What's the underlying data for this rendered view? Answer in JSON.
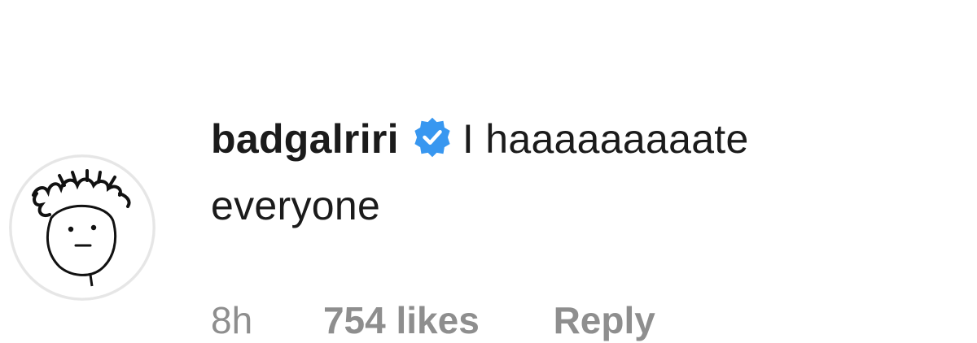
{
  "comment": {
    "username": "badgalriri",
    "verified_icon": "verified-badge-icon",
    "text_line1": "I haaaaaaaaate",
    "text_line2": "everyone",
    "time": "8h",
    "likes": "754 likes",
    "reply_label": "Reply",
    "avatar_icon": "doodle-face-avatar-icon"
  },
  "colors": {
    "text": "#1b1b1b",
    "meta": "#8e8e8e",
    "verified_blue": "#3897f0"
  }
}
